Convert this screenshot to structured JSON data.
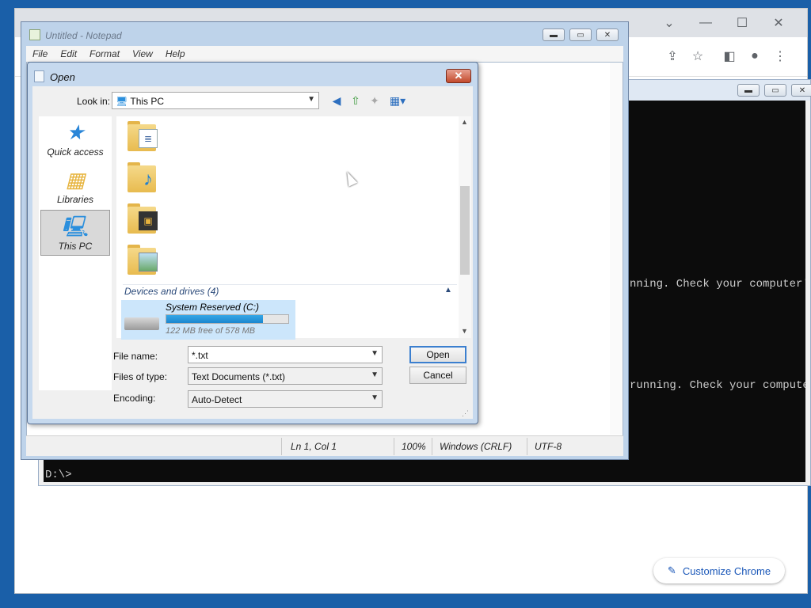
{
  "colors": {
    "accent": "#1a57b8",
    "progress": "#26a0da",
    "selection": "#cce6fb",
    "console_bg": "#0c0c0c"
  },
  "chrome": {
    "customize_label": "Customize Chrome",
    "icons": [
      "chevron-down-icon",
      "minimize-icon",
      "maximize-icon",
      "close-icon",
      "share-icon",
      "star-icon",
      "side-panel-icon",
      "profile-icon",
      "menu-kebab-icon"
    ]
  },
  "console": {
    "lines": [
      "nning. Check your computer's",
      "running. Check your computer",
      "D:\\>"
    ]
  },
  "notepad": {
    "title": "Untitled - Notepad",
    "menu": [
      "File",
      "Edit",
      "Format",
      "View",
      "Help"
    ],
    "status": {
      "position": "Ln 1, Col 1",
      "zoom": "100%",
      "eol": "Windows (CRLF)",
      "encoding": "UTF-8"
    }
  },
  "dialog": {
    "title": "Open",
    "look_in_label": "Look in:",
    "look_in_value": "This PC",
    "sidebar": [
      {
        "label": "Quick access",
        "icon": "quick-access-star-icon"
      },
      {
        "label": "Libraries",
        "icon": "libraries-icon"
      },
      {
        "label": "This PC",
        "icon": "this-pc-icon"
      }
    ],
    "folders": [
      {
        "icon": "documents-folder-icon"
      },
      {
        "icon": "music-folder-icon"
      },
      {
        "icon": "videos-folder-icon"
      },
      {
        "icon": "pictures-folder-icon"
      }
    ],
    "group_header": "Devices and drives (4)",
    "drive": {
      "name": "System Reserved (C:)",
      "free": "122 MB free of 578 MB",
      "used_fraction": 0.79
    },
    "file_name_label": "File name:",
    "file_name_value": "*.txt",
    "files_of_type_label": "Files of type:",
    "files_of_type_value": "Text Documents (*.txt)",
    "encoding_label": "Encoding:",
    "encoding_value": "Auto-Detect",
    "open_button": "Open",
    "cancel_button": "Cancel"
  }
}
